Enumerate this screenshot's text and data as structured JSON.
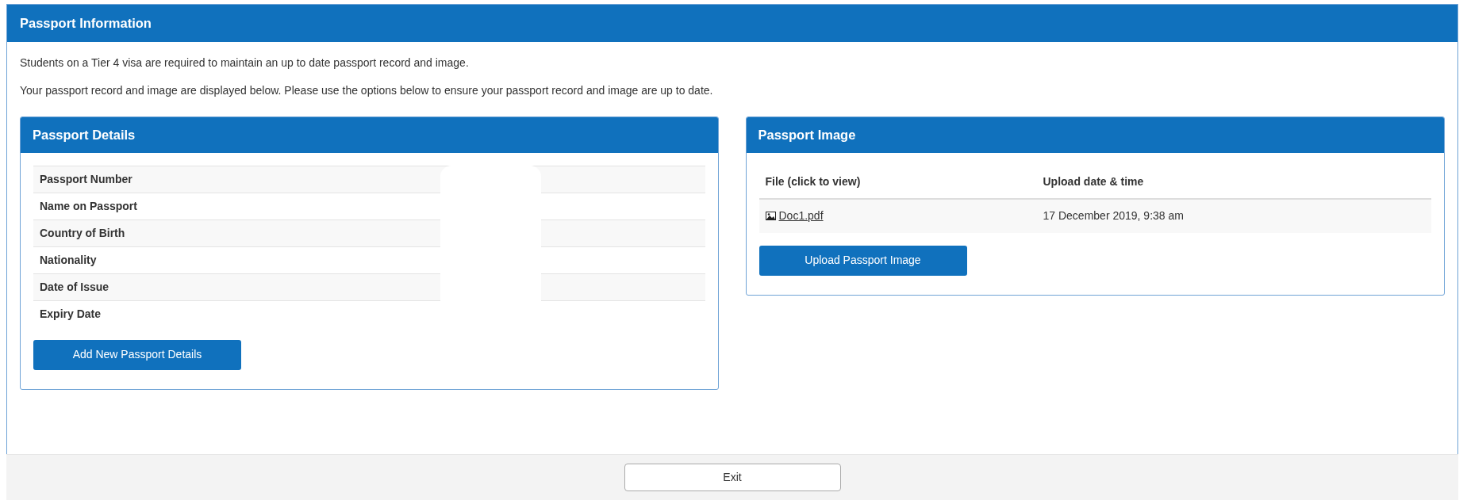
{
  "panel": {
    "title": "Passport Information",
    "intro": [
      "Students on a Tier 4 visa are required to maintain an up to date passport record and image.",
      "Your passport record and image are displayed below. Please use the options below to ensure your passport record and image are up to date."
    ]
  },
  "passport_details": {
    "title": "Passport Details",
    "rows": [
      {
        "label": "Passport Number"
      },
      {
        "label": "Name on Passport"
      },
      {
        "label": "Country of Birth"
      },
      {
        "label": "Nationality"
      },
      {
        "label": "Date of Issue"
      },
      {
        "label": "Expiry Date"
      }
    ],
    "button": "Add New Passport Details"
  },
  "passport_image": {
    "title": "Passport Image",
    "columns": [
      "File (click to view)",
      "Upload date & time"
    ],
    "rows": [
      {
        "file": "Doc1.pdf",
        "uploaded": "17 December 2019, 9:38 am"
      }
    ],
    "button": "Upload Passport Image"
  },
  "footer": {
    "button": "Exit"
  }
}
